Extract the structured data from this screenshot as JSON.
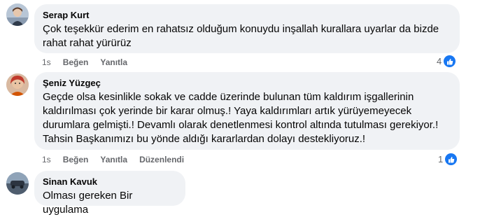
{
  "comments": [
    {
      "author": "Serap Kurt",
      "text_lines": [
        "Çok teşekkür ederim en rahatsız olduğum konuydu inşallah kurallara uyarlar da bizde",
        "rahat rahat yürürüz"
      ],
      "time": "1s",
      "like_label": "Beğen",
      "reply_label": "Yanıtla",
      "reaction_count": "4"
    },
    {
      "author": "Şeniz Yüzgeç",
      "text_lines": [
        "Geçde olsa kesinlikle sokak ve cadde üzerinde bulunan tüm kaldırım işgallerinin",
        "kaldırılması çok yerinde bir karar olmuş.! Yaya kaldırımları artık yürüyemeyecek",
        "durumlara gelmişti.! Devamlı olarak denetlenmesi kontrol altında tutulması gerekiyor.!",
        "Tahsin Başkanımızı bu yönde aldığı kararlardan dolayı destekliyoruz.!"
      ],
      "time": "1s",
      "like_label": "Beğen",
      "reply_label": "Yanıtla",
      "edited_label": "Düzenlendi",
      "reaction_count": "1"
    },
    {
      "author": "Sinan Kavuk",
      "text_lines": [
        "Olması gereken Bir uygulama"
      ]
    }
  ],
  "colors": {
    "bubble": "#f0f2f5",
    "like_blue": "#1877f2",
    "meta_gray": "#65676b"
  }
}
